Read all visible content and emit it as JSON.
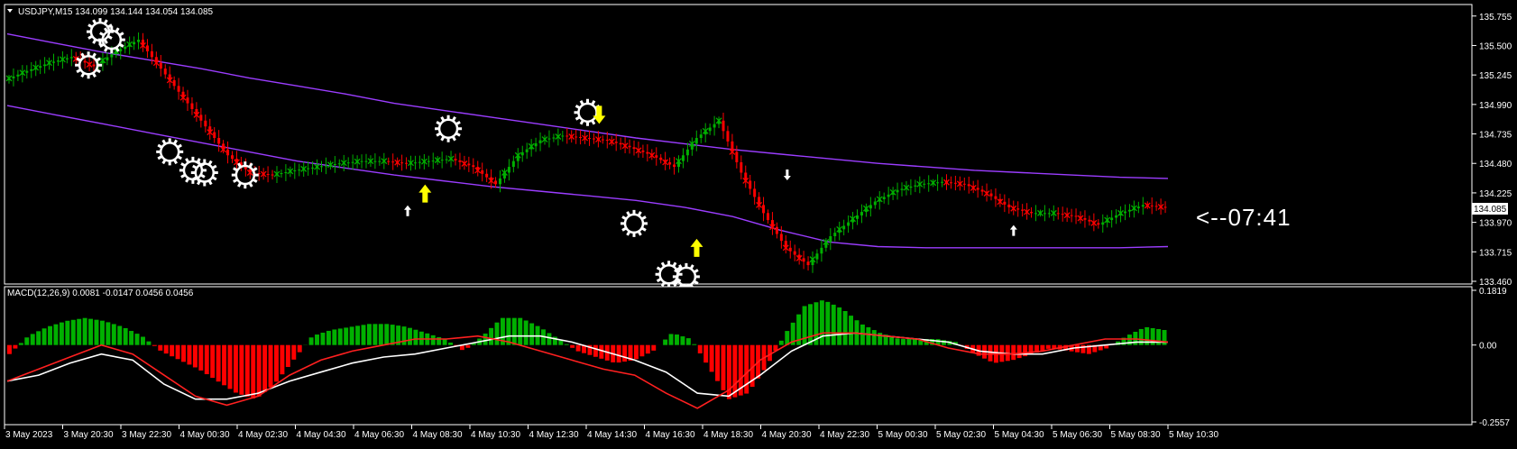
{
  "colors": {
    "background": "#000000",
    "frame": "#ffffff",
    "bull": "#00b000",
    "bear": "#ff0000",
    "channel": "#9b3dff",
    "macd_signal": "#ffffff",
    "macd_line": "#ff2020",
    "arrow_yellow": "#ffff00",
    "text": "#ffffff"
  },
  "chart_data": [
    {
      "type": "line",
      "title": "USDJPY,M15  134.099 134.144 134.054 134.085",
      "symbol": "USDJPY,M15",
      "current_price_label": "134.085",
      "ylim": [
        133.46,
        135.8
      ],
      "yticks": [
        "135.755",
        "135.500",
        "135.245",
        "134.990",
        "134.735",
        "134.480",
        "134.225",
        "133.970",
        "133.715",
        "133.460"
      ],
      "xticks": [
        "3 May 2023",
        "3 May 20:30",
        "3 May 22:30",
        "4 May 00:30",
        "4 May 02:30",
        "4 May 04:30",
        "4 May 06:30",
        "4 May 08:30",
        "4 May 10:30",
        "4 May 12:30",
        "4 May 14:30",
        "4 May 16:30",
        "4 May 18:30",
        "4 May 20:30",
        "4 May 22:30",
        "5 May 00:30",
        "5 May 02:30",
        "5 May 04:30",
        "5 May 06:30",
        "5 May 08:30",
        "5 May 10:30"
      ],
      "annotation": "<--07:41",
      "series": [
        {
          "values": [
            135.2,
            135.28,
            135.35,
            135.4,
            135.32,
            135.45,
            135.55,
            135.3,
            135.05,
            134.8,
            134.55,
            134.4,
            134.38,
            134.42,
            134.45,
            134.48,
            134.5,
            134.5,
            134.48,
            134.5,
            134.52,
            134.45,
            134.3,
            134.55,
            134.68,
            134.72,
            134.7,
            134.68,
            134.62,
            134.55,
            134.45,
            134.7,
            134.85,
            134.4,
            134.05,
            133.75,
            133.6,
            133.85,
            134.0,
            134.15,
            134.25,
            134.3,
            134.32,
            134.3,
            134.22,
            134.1,
            134.05,
            134.05,
            134.02,
            133.95,
            134.05,
            134.12,
            134.1
          ]
        },
        {
          "values": [
            135.6,
            135.52,
            135.44,
            135.37,
            135.3,
            135.22,
            135.15,
            135.08,
            135.0,
            134.94,
            134.88,
            134.82,
            134.76,
            134.7,
            134.65,
            134.6,
            134.56,
            134.52,
            134.48,
            134.45,
            134.42,
            134.4,
            134.38,
            134.36,
            134.35
          ]
        },
        {
          "values": [
            134.98,
            134.9,
            134.82,
            134.74,
            134.66,
            134.58,
            134.5,
            134.44,
            134.38,
            134.33,
            134.28,
            134.24,
            134.2,
            134.16,
            134.1,
            134.02,
            133.9,
            133.8,
            133.76,
            133.75,
            133.75,
            133.75,
            133.75,
            133.75,
            133.76
          ]
        }
      ]
    },
    {
      "type": "bar",
      "title": "MACD(12,26,9) 0.0081 -0.0147 0.0456 0.0456",
      "ylim": [
        -0.2557,
        0.1819
      ],
      "yticks": [
        "0.1819",
        "0.00",
        "-0.2557"
      ],
      "series": [
        {
          "values": [
            -0.03,
            0.03,
            0.06,
            0.08,
            0.09,
            0.08,
            0.06,
            0.03,
            -0.02,
            -0.05,
            -0.08,
            -0.12,
            -0.16,
            -0.18,
            -0.13,
            -0.05,
            0.03,
            0.05,
            0.06,
            0.07,
            0.07,
            0.06,
            0.04,
            0.02,
            -0.02,
            0.03,
            0.09,
            0.09,
            0.06,
            0.02,
            -0.02,
            -0.04,
            -0.06,
            -0.05,
            -0.02,
            0.04,
            0.02,
            -0.08,
            -0.18,
            -0.16,
            -0.07,
            0.04,
            0.13,
            0.15,
            0.12,
            0.07,
            0.04,
            0.02,
            0.02,
            0.02,
            0.01,
            -0.03,
            -0.06,
            -0.05,
            -0.03,
            -0.01,
            -0.02,
            -0.03,
            -0.01,
            0.03,
            0.06,
            0.05
          ]
        },
        {
          "values": [
            -0.12,
            -0.1,
            -0.06,
            -0.03,
            -0.05,
            -0.13,
            -0.18,
            -0.18,
            -0.16,
            -0.12,
            -0.09,
            -0.06,
            -0.04,
            -0.03,
            -0.01,
            0.01,
            0.03,
            0.03,
            0.01,
            -0.02,
            -0.05,
            -0.09,
            -0.16,
            -0.17,
            -0.1,
            -0.02,
            0.03,
            0.04,
            0.03,
            0.02,
            0.01,
            -0.02,
            -0.03,
            -0.03,
            -0.01,
            0.0,
            0.01,
            0.01
          ]
        },
        {
          "values": [
            -0.12,
            -0.08,
            -0.04,
            0.0,
            -0.03,
            -0.1,
            -0.17,
            -0.2,
            -0.17,
            -0.1,
            -0.05,
            -0.02,
            0.0,
            0.02,
            0.02,
            0.03,
            0.01,
            -0.02,
            -0.05,
            -0.08,
            -0.1,
            -0.16,
            -0.21,
            -0.15,
            -0.05,
            0.01,
            0.04,
            0.04,
            0.03,
            0.02,
            -0.01,
            -0.03,
            -0.03,
            -0.02,
            0.0,
            0.02,
            0.02,
            0.01
          ]
        }
      ]
    }
  ]
}
